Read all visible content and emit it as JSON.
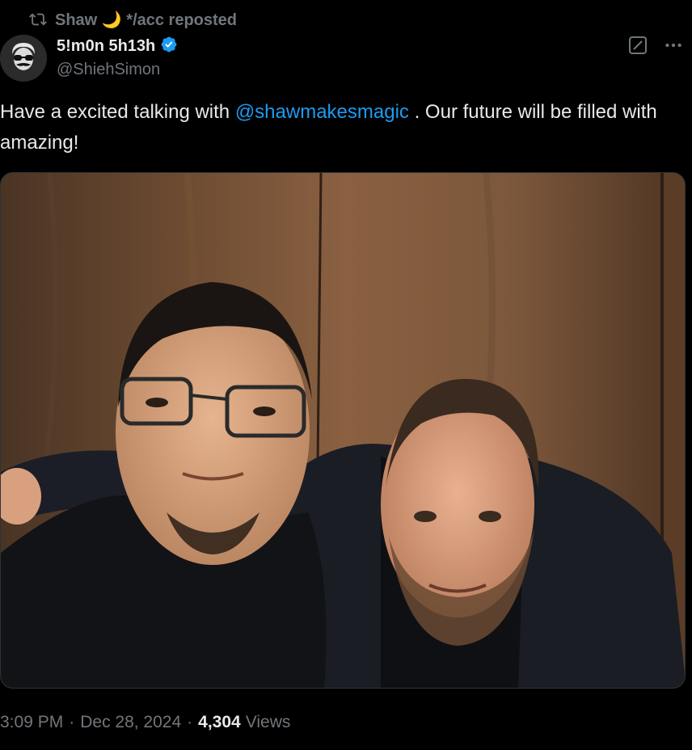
{
  "social_context": {
    "reposter_name": "Shaw",
    "reposter_emoji": "🌙",
    "suffix": "*/acc reposted"
  },
  "author": {
    "display_name": "5!m0n 5h13h",
    "handle": "@ShiehSimon",
    "verified": true,
    "verified_color": "#1d9bf0"
  },
  "tweet": {
    "text_before": "Have a excited talking with ",
    "mention": "@shawmakesmagic",
    "text_after": " . Our future will be filled with amazing!"
  },
  "media": {
    "type": "photo"
  },
  "meta": {
    "time": "3:09 PM",
    "date": "Dec 28, 2024",
    "views_count": "4,304",
    "views_label": "Views"
  },
  "icons": {
    "repost": "repost-icon",
    "verified": "verified-badge-icon",
    "grok": "grok-icon",
    "more": "more-options-icon"
  },
  "colors": {
    "background": "#000000",
    "text": "#e7e9ea",
    "secondary_text": "#71767b",
    "link": "#1d9bf0"
  }
}
